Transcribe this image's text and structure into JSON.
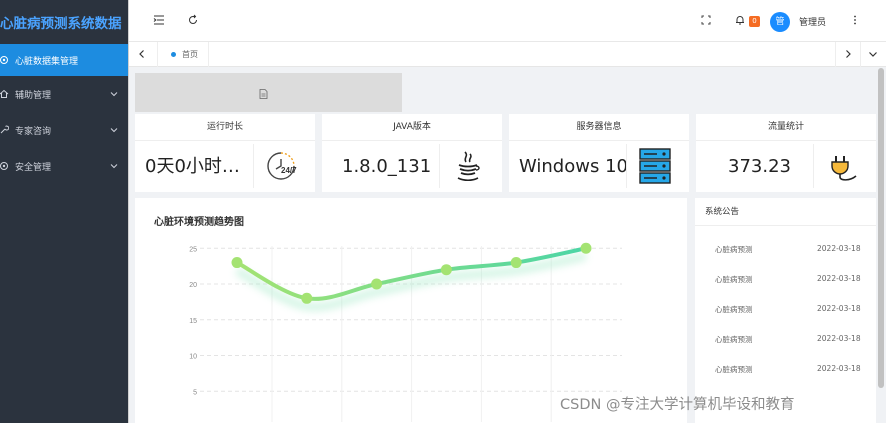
{
  "app": {
    "title": "心脏病预测系统数据"
  },
  "sidebar": {
    "items": [
      {
        "label": "心脏数据集管理",
        "icon": "gear-icon",
        "active": true
      },
      {
        "label": "辅助管理",
        "icon": "home-icon",
        "active": false
      },
      {
        "label": "专家咨询",
        "icon": "tool-icon",
        "active": false
      },
      {
        "label": "安全管理",
        "icon": "gear-icon",
        "active": false
      }
    ]
  },
  "header": {
    "notification_count": "0",
    "avatar_text": "管",
    "user_name": "管理员"
  },
  "tabs": {
    "home_label": "首页"
  },
  "cards": [
    {
      "title": "运行时长",
      "value": "0天0小时…",
      "icon": "clock-24-7-icon"
    },
    {
      "title": "JAVA版本",
      "value": "1.8.0_131",
      "icon": "java-icon"
    },
    {
      "title": "服务器信息",
      "value": "Windows 10",
      "icon": "server-icon"
    },
    {
      "title": "流量统计",
      "value": "373.23",
      "icon": "plug-icon"
    }
  ],
  "chart_data": {
    "type": "line",
    "title": "心脏环境预测趋势图",
    "x": [
      "",
      "",
      "",
      "",
      "",
      ""
    ],
    "series": [
      {
        "values": [
          23,
          18,
          20,
          22,
          23,
          25
        ]
      }
    ],
    "yticks": [
      5,
      10,
      15,
      20,
      25
    ],
    "ylim": [
      0,
      26
    ],
    "grid": true,
    "color": "#4cd5a6",
    "point_color": "#a4e372"
  },
  "notice": {
    "title": "系统公告",
    "rows": [
      {
        "title": "心脏病预测",
        "date": "2022-03-18"
      },
      {
        "title": "心脏病预测",
        "date": "2022-03-18"
      },
      {
        "title": "心脏病预测",
        "date": "2022-03-18"
      },
      {
        "title": "心脏病预测",
        "date": "2022-03-18"
      },
      {
        "title": "心脏病预测",
        "date": "2022-03-18"
      }
    ]
  },
  "watermark": "CSDN @专注大学计算机毕设和教育"
}
